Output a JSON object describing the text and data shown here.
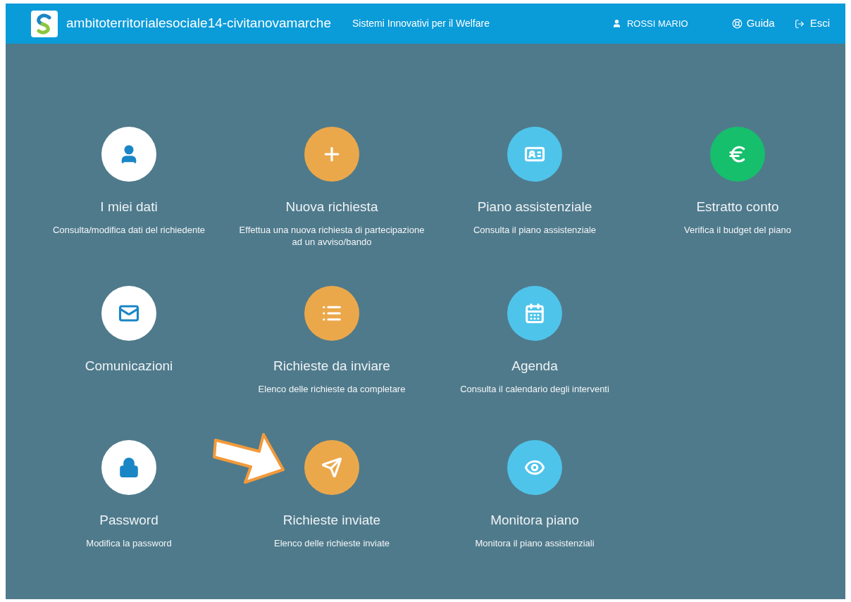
{
  "header": {
    "site": "ambitoterritorialesociale14-civitanovamarche",
    "tagline": "Sistemi Innovativi per il Welfare",
    "user": "ROSSI MARIO",
    "help": "Guida",
    "logout": "Esci"
  },
  "rows": [
    {
      "tiles": [
        {
          "kind": "user",
          "color": "#ffffff",
          "title": "I miei dati",
          "description": "Consulta/modifica dati del richiedente",
          "highlighted": false
        },
        {
          "kind": "plus",
          "color": "#eba84b",
          "title": "Nuova richiesta",
          "description": "Effettua una nuova richiesta di partecipazione ad un avviso/bando",
          "highlighted": false
        },
        {
          "kind": "card",
          "color": "#4fc4ea",
          "title": "Piano assistenziale",
          "description": "Consulta il piano assistenziale",
          "highlighted": false
        },
        {
          "kind": "euro",
          "color": "#16bf6c",
          "title": "Estratto conto",
          "description": "Verifica il budget del piano",
          "highlighted": false
        }
      ]
    },
    {
      "tiles": [
        {
          "kind": "envelope",
          "color": "#ffffff",
          "title": "Comunicazioni",
          "highlighted": false
        },
        {
          "kind": "list",
          "color": "#eba84b",
          "title": "Richieste da inviare",
          "description": "Elenco delle richieste da completare",
          "highlighted": false
        },
        {
          "kind": "calendar",
          "color": "#4fc4ea",
          "title": "Agenda",
          "description": "Consulta il calendario degli interventi",
          "highlighted": false
        }
      ]
    },
    {
      "tiles": [
        {
          "kind": "lock",
          "color": "#ffffff",
          "title": "Password",
          "description": "Modifica la password",
          "highlighted": false
        },
        {
          "kind": "send",
          "color": "#eba84b",
          "title": "Richieste inviate",
          "description": "Elenco delle richieste inviate",
          "highlighted": true
        },
        {
          "kind": "eye",
          "color": "#4fc4ea",
          "title": "Monitora piano",
          "description": "Monitora il piano assistenziali",
          "highlighted": false
        }
      ]
    }
  ]
}
